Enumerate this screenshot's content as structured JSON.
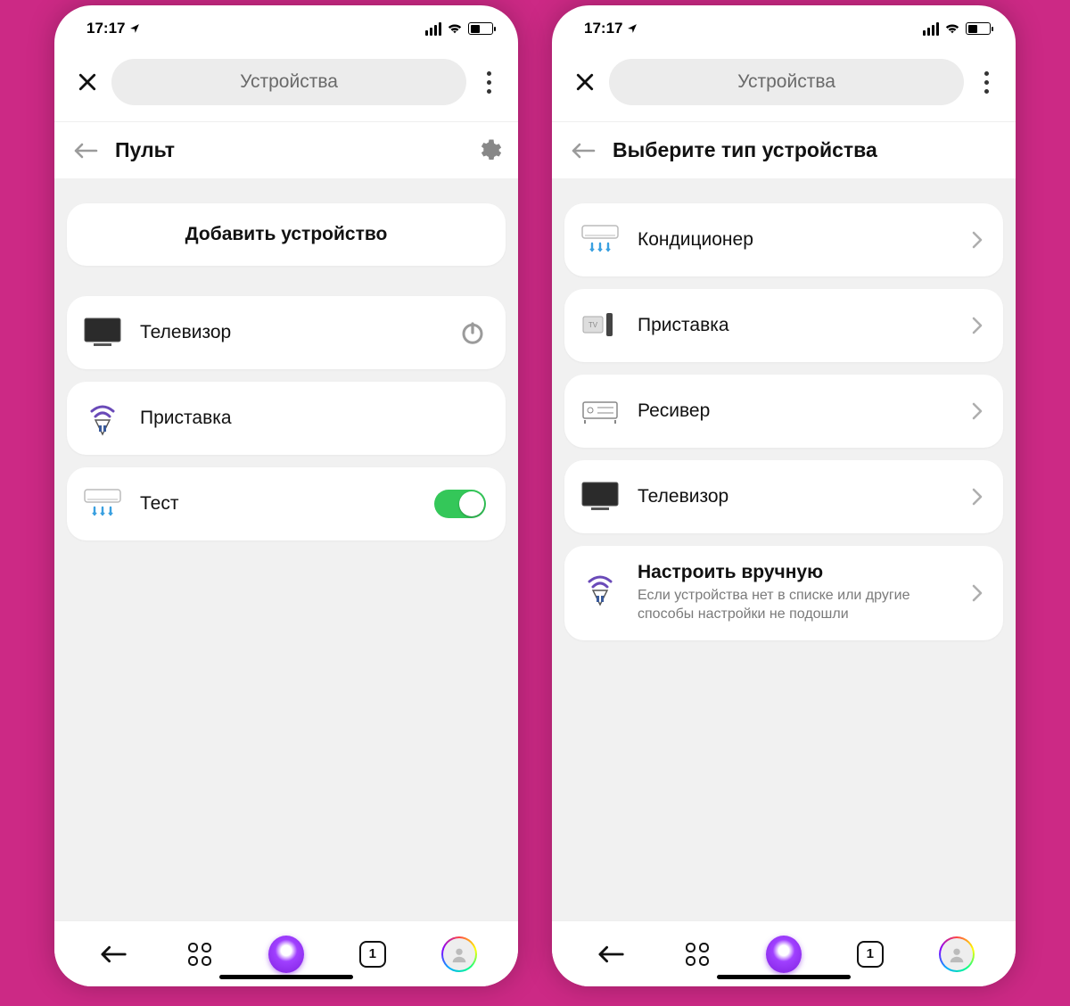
{
  "status": {
    "time": "17:17"
  },
  "topbar": {
    "pill": "Устройства"
  },
  "left": {
    "section_title": "Пульт",
    "add_button": "Добавить устройство",
    "items": [
      {
        "label": "Телевизор"
      },
      {
        "label": "Приставка"
      },
      {
        "label": "Тест"
      }
    ]
  },
  "right": {
    "section_title": "Выберите тип устройства",
    "items": [
      {
        "label": "Кондиционер"
      },
      {
        "label": "Приставка"
      },
      {
        "label": "Ресивер"
      },
      {
        "label": "Телевизор"
      },
      {
        "title": "Настроить вручную",
        "sub": "Если устройства нет в списке или другие способы настройки не подошли"
      }
    ]
  },
  "bottombar": {
    "tab_count": "1"
  }
}
